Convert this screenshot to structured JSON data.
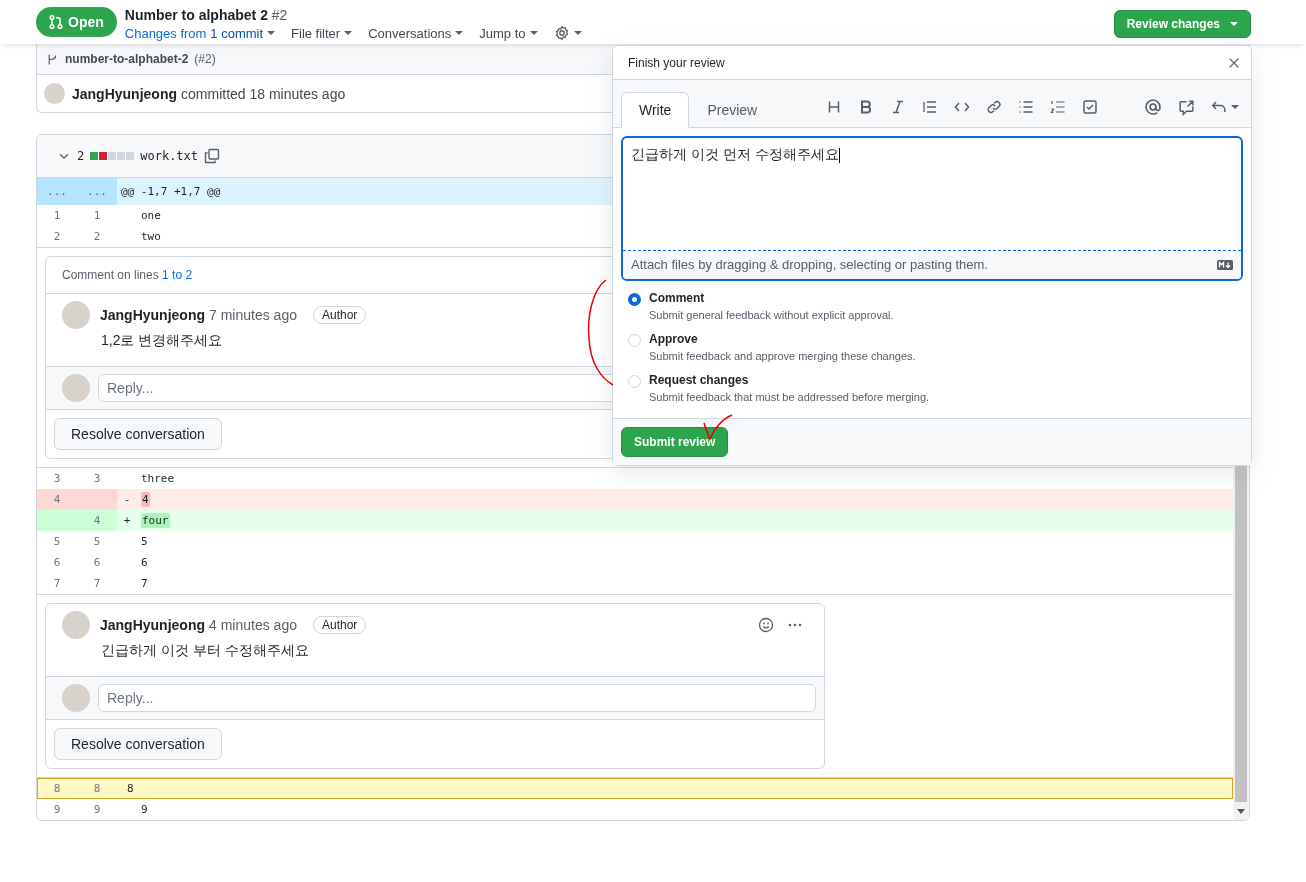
{
  "header": {
    "state": "Open",
    "title": "Number to alphabet 2",
    "number": "#2",
    "menus": [
      {
        "label": "Changes from ",
        "strong": "1 commit",
        "kind": "link"
      },
      {
        "label": "File filter",
        "kind": "menu"
      },
      {
        "label": "Conversations",
        "kind": "menu"
      },
      {
        "label": "Jump to",
        "kind": "menu"
      }
    ],
    "review_button": "Review changes"
  },
  "commit_box": {
    "branch": "number-to-alphabet-2",
    "branch_number": "(#2)",
    "author": "JangHyunjeong",
    "text": "committed 18 minutes ago"
  },
  "file": {
    "expanded": true,
    "changes": "2",
    "diffstat": [
      {
        "color": "#2da44e"
      },
      {
        "color": "#cf222e"
      },
      {
        "color": "#d0d7de"
      },
      {
        "color": "#d0d7de"
      },
      {
        "color": "#d0d7de"
      }
    ],
    "name": "work.txt",
    "hunk": {
      "old": "...",
      "new": "...",
      "text": "@@ -1,7 +1,7 @@"
    },
    "rows": [
      {
        "kind": "context",
        "old": "1",
        "new": "1",
        "text": "one"
      },
      {
        "kind": "context",
        "old": "2",
        "new": "2",
        "text": "two"
      },
      {
        "kind": "thread",
        "caption": "Comment on lines ",
        "range": "1 to 2",
        "author": "JangHyunjeong",
        "time": "7 minutes ago",
        "badge": "Author",
        "body": "1,2로 변경해주세요",
        "reply_placeholder": "Reply...",
        "resolve": "Resolve conversation"
      },
      {
        "kind": "context",
        "old": "3",
        "new": "3",
        "text": "three"
      },
      {
        "kind": "deleted",
        "old": "4",
        "marker": "-",
        "text": "4"
      },
      {
        "kind": "added",
        "new": "4",
        "marker": "+",
        "text": "four"
      },
      {
        "kind": "context",
        "old": "5",
        "new": "5",
        "text": "5"
      },
      {
        "kind": "context",
        "old": "6",
        "new": "6",
        "text": "6"
      },
      {
        "kind": "context",
        "old": "7",
        "new": "7",
        "text": "7"
      },
      {
        "kind": "thread",
        "author": "JangHyunjeong",
        "time": "4 minutes ago",
        "badge": "Author",
        "body": "긴급하게 이것 부터 수정해주세요",
        "reply_placeholder": "Reply...",
        "resolve": "Resolve conversation",
        "actions": true
      },
      {
        "kind": "highlighted",
        "old": "8",
        "new": "8",
        "text": "8"
      },
      {
        "kind": "context",
        "old": "9",
        "new": "9",
        "text": "9"
      }
    ]
  },
  "review_popup": {
    "title": "Finish your review",
    "tabs": [
      {
        "label": "Write",
        "selected": true
      },
      {
        "label": "Preview",
        "selected": false
      }
    ],
    "value": "긴급하게 이것 먼저 수정해주세요",
    "attach_hint": "Attach files by dragging & dropping, selecting or pasting them.",
    "options": [
      {
        "label": "Comment",
        "description": "Submit general feedback without explicit approval.",
        "selected": true
      },
      {
        "label": "Approve",
        "description": "Submit feedback and approve merging these changes.",
        "selected": false
      },
      {
        "label": "Request changes",
        "description": "Submit feedback that must be addressed before merging.",
        "selected": false
      }
    ],
    "submit": "Submit review"
  }
}
